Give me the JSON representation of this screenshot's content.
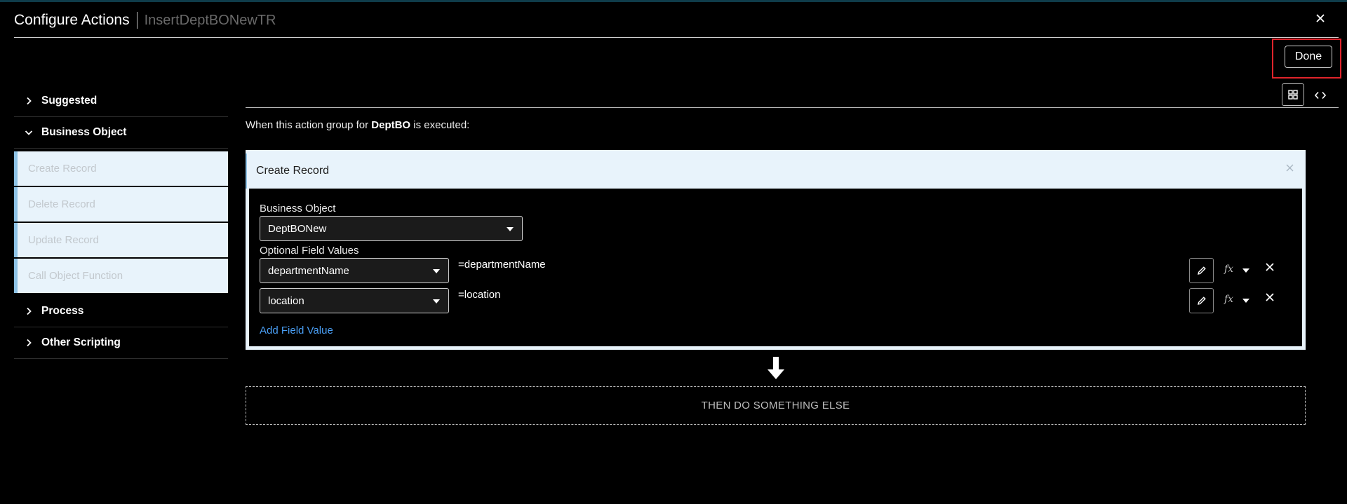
{
  "header": {
    "title": "Configure Actions",
    "subtitle": "InsertDeptBONewTR",
    "close_icon": "close-icon",
    "done_label": "Done"
  },
  "sidebar": {
    "sections": [
      {
        "label": "Suggested",
        "expanded": false
      },
      {
        "label": "Business Object",
        "expanded": true
      },
      {
        "label": "Process",
        "expanded": false
      },
      {
        "label": "Other Scripting",
        "expanded": false
      }
    ],
    "business_object_items": [
      {
        "label": "Create Record"
      },
      {
        "label": "Delete Record"
      },
      {
        "label": "Update Record"
      },
      {
        "label": "Call Object Function"
      }
    ]
  },
  "main": {
    "intro_prefix": "When this action group for",
    "intro_object": "DeptBO",
    "intro_suffix": "is executed:",
    "card": {
      "title": "Create Record",
      "business_object_label": "Business Object",
      "business_object_value": "DeptBONew",
      "optional_fields_label": "Optional Field Values",
      "fields": [
        {
          "name": "departmentName",
          "expression": "=departmentName"
        },
        {
          "name": "location",
          "expression": "=location"
        }
      ],
      "fx_label": "fx",
      "add_field_label": "Add Field Value"
    },
    "then_label": "THEN DO SOMETHING ELSE"
  },
  "colors": {
    "accent_blue": "#4a9ff5",
    "highlight_red": "#e0242b",
    "card_bg": "#e8f3fb",
    "side_accent": "#8ec3e6"
  }
}
